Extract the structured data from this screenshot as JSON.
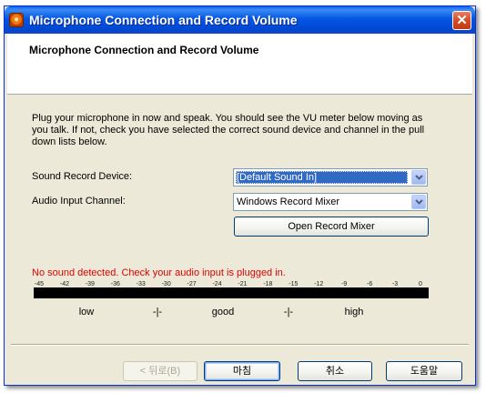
{
  "window": {
    "title": "Microphone Connection and Record Volume",
    "close_glyph": "✕",
    "app_icon": "microphone-app-icon"
  },
  "header": {
    "title": "Microphone Connection and Record Volume"
  },
  "content": {
    "intro_line1": "Plug your microphone in now and speak.  You should see the VU meter below moving as",
    "intro_line2": "you talk.  If not, check you have selected the correct sound device and channel in the pull",
    "intro_line3": "down lists below.",
    "device_label": "Sound Record Device:",
    "device_value": "[Default Sound In]",
    "channel_label": "Audio Input Channel:",
    "channel_value": "Windows Record Mixer",
    "open_mixer_label": "Open Record Mixer",
    "status_text": "No sound detected. Check your audio input is plugged in.",
    "status_color": "#e00000",
    "vu_scale": [
      "-45",
      "-42",
      "-39",
      "-36",
      "-33",
      "-30",
      "-27",
      "-24",
      "-21",
      "-18",
      "-15",
      "-12",
      "-9",
      "-6",
      "-3",
      "0"
    ],
    "vu_level": 0,
    "zones": [
      "low",
      "-|-",
      "good",
      "-|-",
      "high"
    ]
  },
  "footer": {
    "back_label": "< 뒤로(B)",
    "finish_label": "마침",
    "cancel_label": "취소",
    "help_label": "도움말"
  }
}
